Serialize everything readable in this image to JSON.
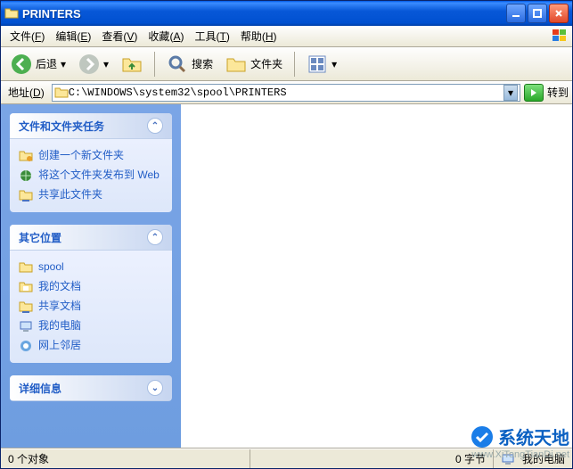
{
  "window": {
    "title": "PRINTERS"
  },
  "menubar": {
    "items": [
      {
        "label": "文件",
        "accel": "F"
      },
      {
        "label": "编辑",
        "accel": "E"
      },
      {
        "label": "查看",
        "accel": "V"
      },
      {
        "label": "收藏",
        "accel": "A"
      },
      {
        "label": "工具",
        "accel": "T"
      },
      {
        "label": "帮助",
        "accel": "H"
      }
    ]
  },
  "toolbar": {
    "back_label": "后退",
    "search_label": "搜索",
    "folders_label": "文件夹"
  },
  "addressbar": {
    "label": "地址",
    "accel": "D",
    "path": "C:\\WINDOWS\\system32\\spool\\PRINTERS",
    "go_label": "转到"
  },
  "sidebar": {
    "panels": [
      {
        "title": "文件和文件夹任务",
        "items": [
          {
            "icon": "new-folder",
            "text": "创建一个新文件夹"
          },
          {
            "icon": "publish-web",
            "text": "将这个文件夹发布到 Web"
          },
          {
            "icon": "share-folder",
            "text": "共享此文件夹"
          }
        ]
      },
      {
        "title": "其它位置",
        "items": [
          {
            "icon": "folder",
            "text": "spool"
          },
          {
            "icon": "my-docs",
            "text": "我的文档"
          },
          {
            "icon": "shared-docs",
            "text": "共享文档"
          },
          {
            "icon": "my-computer",
            "text": "我的电脑"
          },
          {
            "icon": "network",
            "text": "网上邻居"
          }
        ]
      },
      {
        "title": "详细信息",
        "items": []
      }
    ]
  },
  "statusbar": {
    "items_count": "0 个对象",
    "size": "0 字节",
    "zone": "我的电脑"
  },
  "watermark": {
    "brand": "系统天地",
    "url": "www.XiTongTianDi.net"
  }
}
